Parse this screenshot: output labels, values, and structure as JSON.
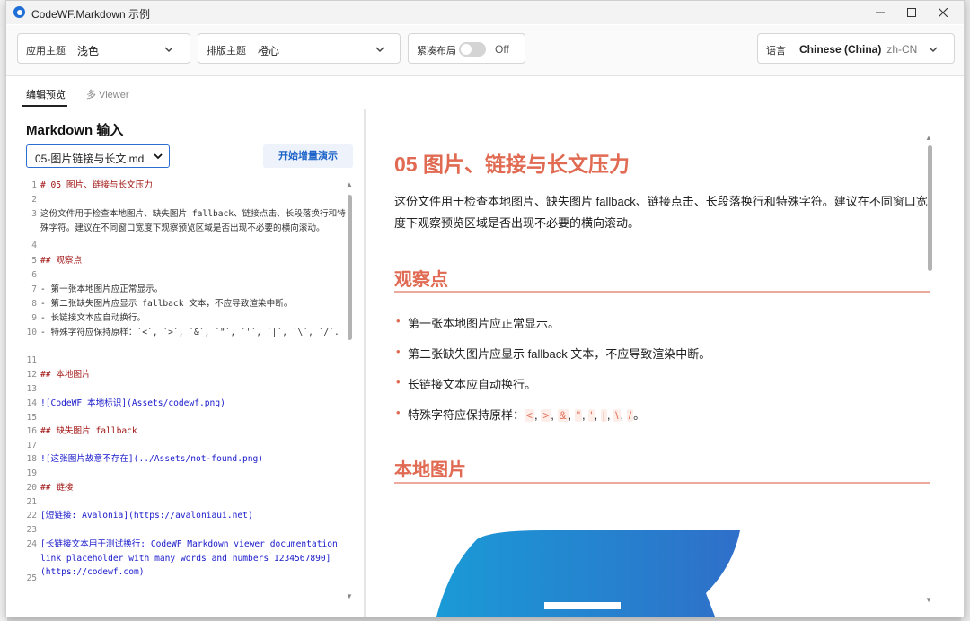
{
  "window": {
    "title": "CodeWF.Markdown 示例"
  },
  "toolbar": {
    "app_theme": {
      "label": "应用主题",
      "value": "浅色"
    },
    "layout_theme": {
      "label": "排版主题",
      "value": "橙心"
    },
    "compact": {
      "label": "紧凑布局",
      "state": "Off"
    },
    "language": {
      "label": "语言",
      "value": "Chinese (China)",
      "code": "zh-CN"
    }
  },
  "tabs": [
    {
      "label": "编辑预览",
      "active": true
    },
    {
      "label": "多 Viewer",
      "active": false
    }
  ],
  "editor": {
    "title": "Markdown 输入",
    "file": "05-图片链接与长文.md",
    "demo_button": "开始增量演示",
    "lines": [
      {
        "n": "1",
        "text": "# 05 图片、链接与长文压力",
        "kind": "heading"
      },
      {
        "n": "2",
        "text": "",
        "kind": "text"
      },
      {
        "n": "3",
        "text": "这份文件用于检查本地图片、缺失图片 fallback、链接点击、长段落换行和特殊字符。建议在不同窗口宽度下观察预览区域是否出现不必要的横向滚动。",
        "kind": "text"
      },
      {
        "n": "4",
        "text": "",
        "kind": "text"
      },
      {
        "n": "5",
        "text": "## 观察点",
        "kind": "heading"
      },
      {
        "n": "6",
        "text": "",
        "kind": "text"
      },
      {
        "n": "7",
        "text": "- 第一张本地图片应正常显示。",
        "kind": "text"
      },
      {
        "n": "8",
        "text": "- 第二张缺失图片应显示 fallback 文本，不应导致渲染中断。",
        "kind": "text"
      },
      {
        "n": "9",
        "text": "- 长链接文本应自动换行。",
        "kind": "text"
      },
      {
        "n": "10",
        "text": "- 特殊字符应保持原样：`<`, `>`, `&`, `\"`, `'`, `|`, `\\`, `/`.",
        "kind": "text"
      },
      {
        "n": "11",
        "text": "",
        "kind": "text"
      },
      {
        "n": "12",
        "text": "## 本地图片",
        "kind": "heading"
      },
      {
        "n": "13",
        "text": "",
        "kind": "text"
      },
      {
        "n": "14",
        "text": "![CodeWF 本地标识](Assets/codewf.png)",
        "kind": "link"
      },
      {
        "n": "15",
        "text": "",
        "kind": "text"
      },
      {
        "n": "16",
        "text": "## 缺失图片 fallback",
        "kind": "heading"
      },
      {
        "n": "17",
        "text": "",
        "kind": "text"
      },
      {
        "n": "18",
        "text": "![这张图片故意不存在](../Assets/not-found.png)",
        "kind": "link"
      },
      {
        "n": "19",
        "text": "",
        "kind": "text"
      },
      {
        "n": "20",
        "text": "## 链接",
        "kind": "heading"
      },
      {
        "n": "21",
        "text": "",
        "kind": "text"
      },
      {
        "n": "22",
        "text": "[短链接: Avalonia](https://avaloniaui.net)",
        "kind": "link"
      },
      {
        "n": "23",
        "text": "",
        "kind": "text"
      },
      {
        "n": "24",
        "text": "[长链接文本用于测试换行: CodeWF Markdown viewer documentation link placeholder with many words and numbers 1234567890](https://codewf.com)",
        "kind": "link"
      },
      {
        "n": "25",
        "text": "",
        "kind": "text"
      }
    ]
  },
  "preview": {
    "h1": "05 图片、链接与长文压力",
    "para": "这份文件用于检查本地图片、缺失图片 fallback、链接点击、长段落换行和特殊字符。建议在不同窗口宽度下观察预览区域是否出现不必要的横向滚动。",
    "h2_observe": "观察点",
    "items": [
      "第一张本地图片应正常显示。",
      "第二张缺失图片应显示 fallback 文本，不应导致渲染中断。",
      "长链接文本应自动换行。"
    ],
    "special_label": "特殊字符应保持原样：",
    "special_chars": [
      "<",
      ">",
      "&",
      "\"",
      "'",
      "|",
      "\\",
      "/"
    ],
    "special_end": "。",
    "h2_local": "本地图片"
  },
  "colors": {
    "accent": "#e06a52",
    "link": "#1a1acb",
    "heading_md": "#a11515",
    "button_text": "#1e64c8"
  }
}
